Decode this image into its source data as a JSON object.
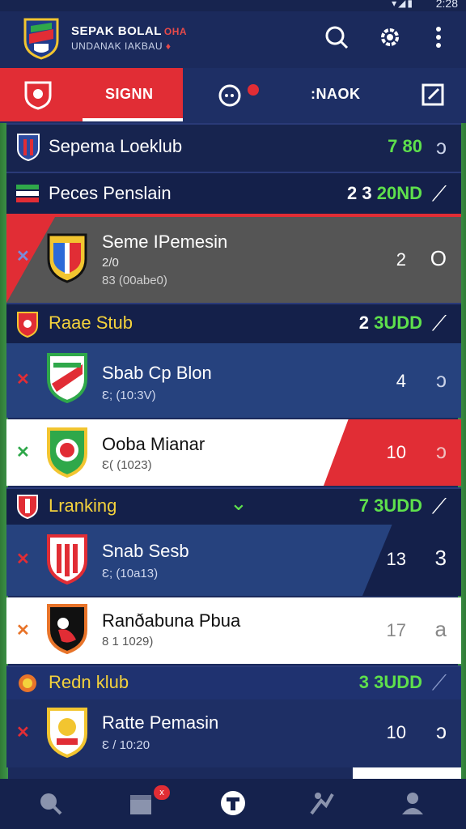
{
  "status_bar": {
    "time": "2:28",
    "icons": "▾◢▮"
  },
  "app": {
    "title": "SEPAK BOLAL",
    "title_accent": "OHA",
    "subtitle": "UNDANAK IAKBAU",
    "subtitle_accent": "♦"
  },
  "header_icons": [
    "search-icon",
    "settings-icon",
    "more-icon"
  ],
  "tabs": [
    {
      "label": "SIGNN",
      "icon": "shield-icon",
      "active": true
    },
    {
      "label": "",
      "icon": "chat-bell-icon",
      "active": false
    },
    {
      "label": ":NAOK",
      "icon": "",
      "active": false
    },
    {
      "label": "",
      "icon": "edit-icon",
      "active": false
    }
  ],
  "sections": [
    {
      "title": "Sepema Loeklub",
      "score_num": "",
      "score_grn": "7 80",
      "end": "ↄ"
    },
    {
      "title": "Peces Penslain",
      "score_num": "2 3",
      "score_grn": "20ND",
      "end": "⟋"
    },
    {
      "title": "Raae Stub",
      "score_num": "2",
      "score_grn": "3UDD",
      "end": "⟋"
    },
    {
      "title": "Lranking",
      "score_num": "",
      "score_grn": "7 3UDD",
      "end": "⟋",
      "chevron": "⌄"
    },
    {
      "title": "Redn klub",
      "score_num": "",
      "score_grn": "3 3UDD",
      "end": "⟋"
    }
  ],
  "rows": [
    {
      "name": "Seme IPemesin",
      "meta1": "2/0",
      "meta2": "83 (00abe0)",
      "num": "2",
      "end": "O",
      "mark": "✕"
    },
    {
      "name": "Sbab Cp Blon",
      "meta": "Ɛ; (10:3V)",
      "num": "4",
      "end": "ↄ",
      "mark": "✕"
    },
    {
      "name": "Ooba Mianar",
      "meta": "Ɛ( (1023)",
      "num": "10",
      "end": "ↄ",
      "mark": "✕"
    },
    {
      "name": "Snab Sesb",
      "meta": "Ɛ; (10a13)",
      "num": "13",
      "end": "3",
      "mark": "✕"
    },
    {
      "name": "Ranðabuna Pbua",
      "meta": "8 1 1029)",
      "num": "17",
      "end": "a",
      "mark": "✕"
    },
    {
      "name": "Ratte Pemasin",
      "meta": "Ɛ / 10:20",
      "num": "10",
      "end": "ↄ",
      "mark": "✕"
    }
  ],
  "bottom_nav": [
    {
      "icon": "search-icon"
    },
    {
      "icon": "calendar-icon",
      "badge": "x"
    },
    {
      "icon": "ball-icon"
    },
    {
      "icon": "stats-icon"
    },
    {
      "icon": "profile-icon"
    }
  ],
  "colors": {
    "accent": "#e12d35",
    "navy": "#1b2a5c",
    "green": "#5ee04c",
    "gold": "#f4d23c"
  }
}
